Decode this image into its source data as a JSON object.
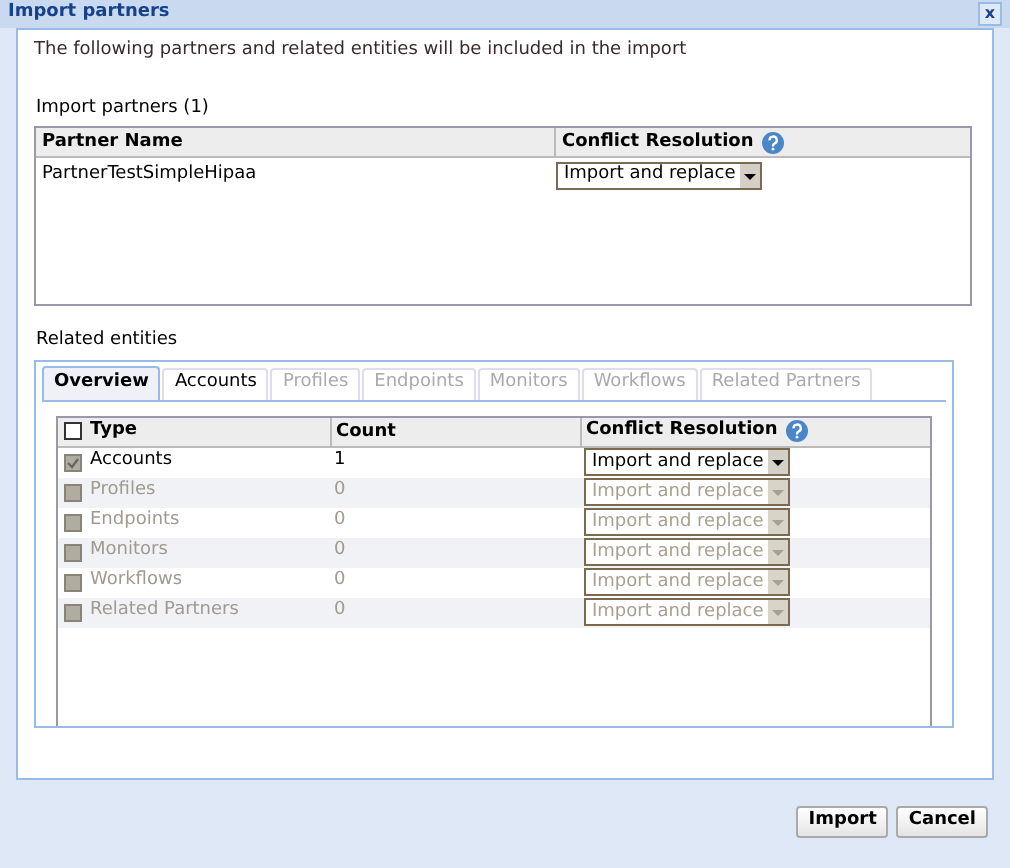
{
  "window": {
    "title": "Import partners",
    "close": "x"
  },
  "intro": "The following partners and related entities will be included in the import",
  "partners": {
    "label": "Import partners (1)",
    "columns": [
      "Partner Name",
      "Conflict Resolution"
    ],
    "rows": [
      {
        "name": "PartnerTestSimpleHipaa",
        "resolution": "Import and replace"
      }
    ]
  },
  "related": {
    "label": "Related entities",
    "tabs": [
      {
        "label": "Overview",
        "selected": true,
        "disabled": false
      },
      {
        "label": "Accounts",
        "selected": false,
        "disabled": false
      },
      {
        "label": "Profiles",
        "selected": false,
        "disabled": true
      },
      {
        "label": "Endpoints",
        "selected": false,
        "disabled": true
      },
      {
        "label": "Monitors",
        "selected": false,
        "disabled": true
      },
      {
        "label": "Workflows",
        "selected": false,
        "disabled": true
      },
      {
        "label": "Related Partners",
        "selected": false,
        "disabled": true
      }
    ],
    "columns": [
      "Type",
      "Count",
      "Conflict Resolution"
    ],
    "header_checked": false,
    "rows": [
      {
        "type": "Accounts",
        "count": "1",
        "resolution": "Import and replace",
        "checked": true,
        "disabled": false
      },
      {
        "type": "Profiles",
        "count": "0",
        "resolution": "Import and replace",
        "checked": false,
        "disabled": true
      },
      {
        "type": "Endpoints",
        "count": "0",
        "resolution": "Import and replace",
        "checked": false,
        "disabled": true
      },
      {
        "type": "Monitors",
        "count": "0",
        "resolution": "Import and replace",
        "checked": false,
        "disabled": true
      },
      {
        "type": "Workflows",
        "count": "0",
        "resolution": "Import and replace",
        "checked": false,
        "disabled": true
      },
      {
        "type": "Related Partners",
        "count": "0",
        "resolution": "Import and replace",
        "checked": false,
        "disabled": true
      }
    ]
  },
  "buttons": [
    "Import",
    "Cancel"
  ]
}
